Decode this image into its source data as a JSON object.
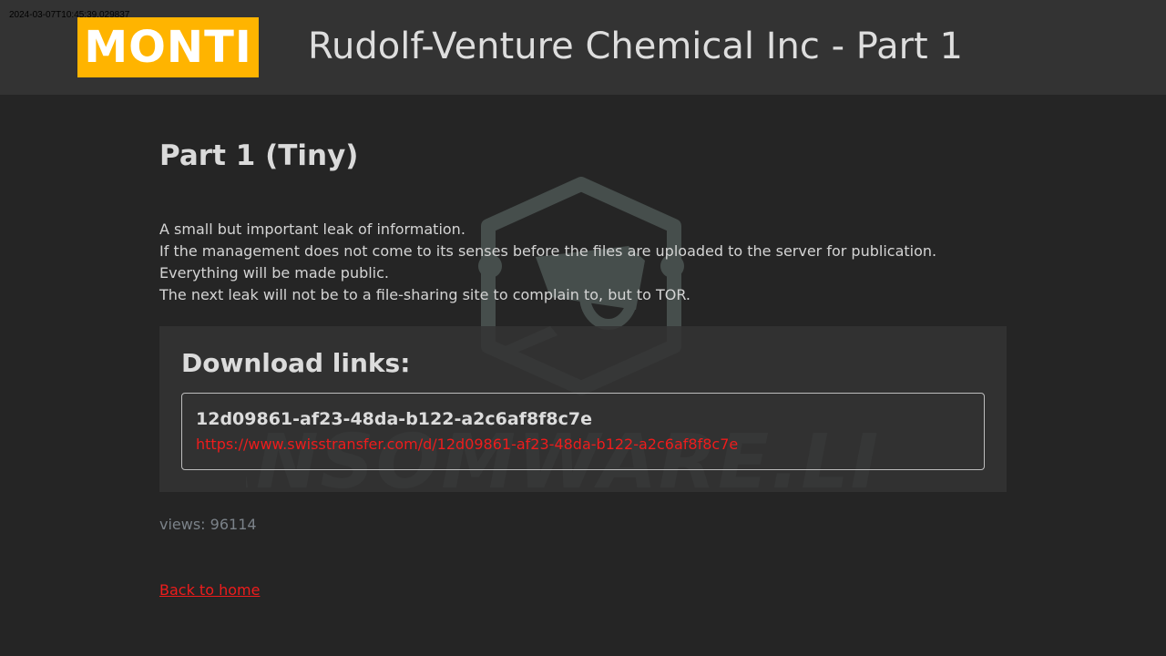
{
  "timestamp": "2024-03-07T10:45:39.029837",
  "header": {
    "logo_text": "MONTI",
    "title": "Rudolf-Venture Chemical Inc - Part 1"
  },
  "main": {
    "heading": "Part 1 (Tiny)",
    "description": [
      "A small but important leak of information.",
      "If the management does not come to its senses before the files are uploaded to the server for publication.",
      "Everything will be made public.",
      "The next leak will not be to a file-sharing site to complain to, but to TOR."
    ],
    "downloads": {
      "title": "Download links:",
      "links": [
        {
          "name": "12d09861-af23-48da-b122-a2c6af8f8c7e",
          "url": "https://www.swisstransfer.com/d/12d09861-af23-48da-b122-a2c6af8f8c7e"
        }
      ]
    },
    "views": "views: 96114",
    "back_link": "Back to home"
  },
  "watermark": {
    "text": "RANSOMWARE.LIVE",
    "icon": "hexagon-camera-icon"
  },
  "colors": {
    "background": "#252525",
    "header_bg": "#333333",
    "logo_bg": "#ffb400",
    "link": "#ee1c1c",
    "muted": "#7b8289"
  }
}
